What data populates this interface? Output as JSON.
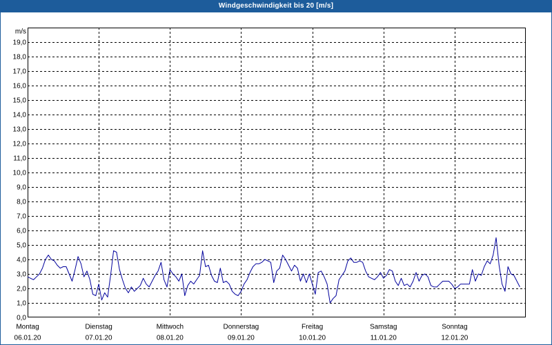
{
  "colors": {
    "title_bar": "#1d5c9b",
    "title_text": "#ffffff",
    "line": "#00009c",
    "grid": "#000000",
    "background": "#ffffff"
  },
  "chart_data": {
    "type": "line",
    "title": "Windgeschwindigkeit bis 20 [m/s]",
    "ylabel": "m/s",
    "ylim": [
      0,
      20
    ],
    "grid": true,
    "yticks": [
      "0,0",
      "1,0",
      "2,0",
      "3,0",
      "4,0",
      "5,0",
      "6,0",
      "7,0",
      "8,0",
      "9,0",
      "10,0",
      "11,0",
      "12,0",
      "13,0",
      "14,0",
      "15,0",
      "16,0",
      "17,0",
      "18,0",
      "19,0"
    ],
    "xticks": [
      {
        "day": "Montag",
        "date": "06.01.20"
      },
      {
        "day": "Dienstag",
        "date": "07.01.20"
      },
      {
        "day": "Mittwoch",
        "date": "08.01.20"
      },
      {
        "day": "Donnerstag",
        "date": "09.01.20"
      },
      {
        "day": "Freitag",
        "date": "10.01.20"
      },
      {
        "day": "Samstag",
        "date": "11.01.20"
      },
      {
        "day": "Sonntag",
        "date": "12.01.20"
      }
    ],
    "series": [
      {
        "points": [
          [
            "06.01.20 00:00",
            2.8
          ],
          [
            "06.01.20 01:00",
            2.7
          ],
          [
            "06.01.20 02:00",
            2.6
          ],
          [
            "06.01.20 03:00",
            2.8
          ],
          [
            "06.01.20 04:00",
            3.0
          ],
          [
            "06.01.20 05:00",
            3.4
          ],
          [
            "06.01.20 06:00",
            4.0
          ],
          [
            "06.01.20 07:00",
            4.3
          ],
          [
            "06.01.20 08:00",
            4.0
          ],
          [
            "06.01.20 09:00",
            3.9
          ],
          [
            "06.01.20 10:00",
            3.6
          ],
          [
            "06.01.20 11:00",
            3.4
          ],
          [
            "06.01.20 12:00",
            3.5
          ],
          [
            "06.01.20 13:00",
            3.5
          ],
          [
            "06.01.20 14:00",
            3.0
          ],
          [
            "06.01.20 15:00",
            2.5
          ],
          [
            "06.01.20 16:00",
            3.3
          ],
          [
            "06.01.20 17:00",
            4.2
          ],
          [
            "06.01.20 18:00",
            3.7
          ],
          [
            "06.01.20 19:00",
            2.8
          ],
          [
            "06.01.20 20:00",
            3.2
          ],
          [
            "06.01.20 21:00",
            2.6
          ],
          [
            "06.01.20 22:00",
            1.6
          ],
          [
            "06.01.20 23:00",
            1.5
          ],
          [
            "07.01.20 00:00",
            2.3
          ],
          [
            "07.01.20 01:00",
            1.2
          ],
          [
            "07.01.20 02:00",
            1.7
          ],
          [
            "07.01.20 03:00",
            1.4
          ],
          [
            "07.01.20 04:00",
            2.9
          ],
          [
            "07.01.20 05:00",
            4.6
          ],
          [
            "07.01.20 06:00",
            4.5
          ],
          [
            "07.01.20 07:00",
            3.3
          ],
          [
            "07.01.20 08:00",
            2.6
          ],
          [
            "07.01.20 09:00",
            2.0
          ],
          [
            "07.01.20 10:00",
            1.7
          ],
          [
            "07.01.20 11:00",
            2.1
          ],
          [
            "07.01.20 12:00",
            1.8
          ],
          [
            "07.01.20 13:00",
            2.0
          ],
          [
            "07.01.20 14:00",
            2.2
          ],
          [
            "07.01.20 15:00",
            2.7
          ],
          [
            "07.01.20 16:00",
            2.3
          ],
          [
            "07.01.20 17:00",
            2.1
          ],
          [
            "07.01.20 18:00",
            2.5
          ],
          [
            "07.01.20 19:00",
            2.9
          ],
          [
            "07.01.20 20:00",
            3.2
          ],
          [
            "07.01.20 21:00",
            3.8
          ],
          [
            "07.01.20 22:00",
            2.6
          ],
          [
            "07.01.20 23:00",
            2.1
          ],
          [
            "08.01.20 00:00",
            3.3
          ],
          [
            "08.01.20 01:00",
            3.0
          ],
          [
            "08.01.20 02:00",
            2.8
          ],
          [
            "08.01.20 03:00",
            2.5
          ],
          [
            "08.01.20 04:00",
            3.0
          ],
          [
            "08.01.20 05:00",
            1.5
          ],
          [
            "08.01.20 06:00",
            2.2
          ],
          [
            "08.01.20 07:00",
            2.5
          ],
          [
            "08.01.20 08:00",
            2.3
          ],
          [
            "08.01.20 09:00",
            2.6
          ],
          [
            "08.01.20 10:00",
            2.9
          ],
          [
            "08.01.20 11:00",
            4.6
          ],
          [
            "08.01.20 12:00",
            3.5
          ],
          [
            "08.01.20 13:00",
            3.6
          ],
          [
            "08.01.20 14:00",
            2.9
          ],
          [
            "08.01.20 15:00",
            2.5
          ],
          [
            "08.01.20 16:00",
            2.4
          ],
          [
            "08.01.20 17:00",
            3.4
          ],
          [
            "08.01.20 18:00",
            2.4
          ],
          [
            "08.01.20 19:00",
            2.5
          ],
          [
            "08.01.20 20:00",
            2.3
          ],
          [
            "08.01.20 21:00",
            1.8
          ],
          [
            "08.01.20 22:00",
            1.6
          ],
          [
            "08.01.20 23:00",
            1.5
          ],
          [
            "09.01.20 00:00",
            1.8
          ],
          [
            "09.01.20 01:00",
            2.3
          ],
          [
            "09.01.20 02:00",
            2.6
          ],
          [
            "09.01.20 03:00",
            3.1
          ],
          [
            "09.01.20 04:00",
            3.5
          ],
          [
            "09.01.20 05:00",
            3.7
          ],
          [
            "09.01.20 06:00",
            3.7
          ],
          [
            "09.01.20 07:00",
            3.8
          ],
          [
            "09.01.20 08:00",
            4.0
          ],
          [
            "09.01.20 09:00",
            3.9
          ],
          [
            "09.01.20 10:00",
            3.8
          ],
          [
            "09.01.20 11:00",
            2.4
          ],
          [
            "09.01.20 12:00",
            3.2
          ],
          [
            "09.01.20 13:00",
            3.4
          ],
          [
            "09.01.20 14:00",
            4.3
          ],
          [
            "09.01.20 15:00",
            4.0
          ],
          [
            "09.01.20 16:00",
            3.6
          ],
          [
            "09.01.20 17:00",
            3.2
          ],
          [
            "09.01.20 18:00",
            3.6
          ],
          [
            "09.01.20 19:00",
            3.4
          ],
          [
            "09.01.20 20:00",
            2.5
          ],
          [
            "09.01.20 21:00",
            3.0
          ],
          [
            "09.01.20 22:00",
            2.4
          ],
          [
            "09.01.20 23:00",
            3.0
          ],
          [
            "10.01.20 00:00",
            2.3
          ],
          [
            "10.01.20 01:00",
            1.6
          ],
          [
            "10.01.20 02:00",
            3.1
          ],
          [
            "10.01.20 03:00",
            3.2
          ],
          [
            "10.01.20 04:00",
            2.8
          ],
          [
            "10.01.20 05:00",
            2.3
          ],
          [
            "10.01.20 06:00",
            1.0
          ],
          [
            "10.01.20 07:00",
            1.3
          ],
          [
            "10.01.20 08:00",
            1.5
          ],
          [
            "10.01.20 09:00",
            2.6
          ],
          [
            "10.01.20 10:00",
            2.9
          ],
          [
            "10.01.20 11:00",
            3.2
          ],
          [
            "10.01.20 12:00",
            3.9
          ],
          [
            "10.01.20 13:00",
            4.1
          ],
          [
            "10.01.20 14:00",
            3.8
          ],
          [
            "10.01.20 15:00",
            3.8
          ],
          [
            "10.01.20 16:00",
            3.9
          ],
          [
            "10.01.20 17:00",
            3.8
          ],
          [
            "10.01.20 18:00",
            3.2
          ],
          [
            "10.01.20 19:00",
            2.8
          ],
          [
            "10.01.20 20:00",
            2.7
          ],
          [
            "10.01.20 21:00",
            2.6
          ],
          [
            "10.01.20 22:00",
            2.8
          ],
          [
            "10.01.20 23:00",
            3.1
          ],
          [
            "11.01.20 00:00",
            2.7
          ],
          [
            "11.01.20 01:00",
            2.9
          ],
          [
            "11.01.20 02:00",
            3.3
          ],
          [
            "11.01.20 03:00",
            3.2
          ],
          [
            "11.01.20 04:00",
            2.5
          ],
          [
            "11.01.20 05:00",
            2.2
          ],
          [
            "11.01.20 06:00",
            2.7
          ],
          [
            "11.01.20 07:00",
            2.2
          ],
          [
            "11.01.20 08:00",
            2.3
          ],
          [
            "11.01.20 09:00",
            2.1
          ],
          [
            "11.01.20 10:00",
            2.5
          ],
          [
            "11.01.20 11:00",
            3.1
          ],
          [
            "11.01.20 12:00",
            2.5
          ],
          [
            "11.01.20 13:00",
            2.9
          ],
          [
            "11.01.20 14:00",
            3.0
          ],
          [
            "11.01.20 15:00",
            2.8
          ],
          [
            "11.01.20 16:00",
            2.2
          ],
          [
            "11.01.20 17:00",
            2.1
          ],
          [
            "11.01.20 18:00",
            2.1
          ],
          [
            "11.01.20 19:00",
            2.3
          ],
          [
            "11.01.20 20:00",
            2.5
          ],
          [
            "11.01.20 21:00",
            2.5
          ],
          [
            "11.01.20 22:00",
            2.5
          ],
          [
            "11.01.20 23:00",
            2.3
          ],
          [
            "12.01.20 00:00",
            2.0
          ],
          [
            "12.01.20 01:00",
            2.1
          ],
          [
            "12.01.20 02:00",
            2.3
          ],
          [
            "12.01.20 03:00",
            2.3
          ],
          [
            "12.01.20 04:00",
            2.3
          ],
          [
            "12.01.20 05:00",
            2.3
          ],
          [
            "12.01.20 06:00",
            3.3
          ],
          [
            "12.01.20 07:00",
            2.5
          ],
          [
            "12.01.20 08:00",
            3.0
          ],
          [
            "12.01.20 09:00",
            2.9
          ],
          [
            "12.01.20 10:00",
            3.5
          ],
          [
            "12.01.20 11:00",
            3.9
          ],
          [
            "12.01.20 12:00",
            3.7
          ],
          [
            "12.01.20 13:00",
            4.3
          ],
          [
            "12.01.20 14:00",
            5.5
          ],
          [
            "12.01.20 15:00",
            3.6
          ],
          [
            "12.01.20 16:00",
            2.3
          ],
          [
            "12.01.20 17:00",
            1.8
          ],
          [
            "12.01.20 18:00",
            3.5
          ],
          [
            "12.01.20 19:00",
            3.0
          ],
          [
            "12.01.20 20:00",
            2.9
          ],
          [
            "12.01.20 21:00",
            2.5
          ],
          [
            "12.01.20 22:00",
            2.1
          ]
        ]
      }
    ]
  }
}
